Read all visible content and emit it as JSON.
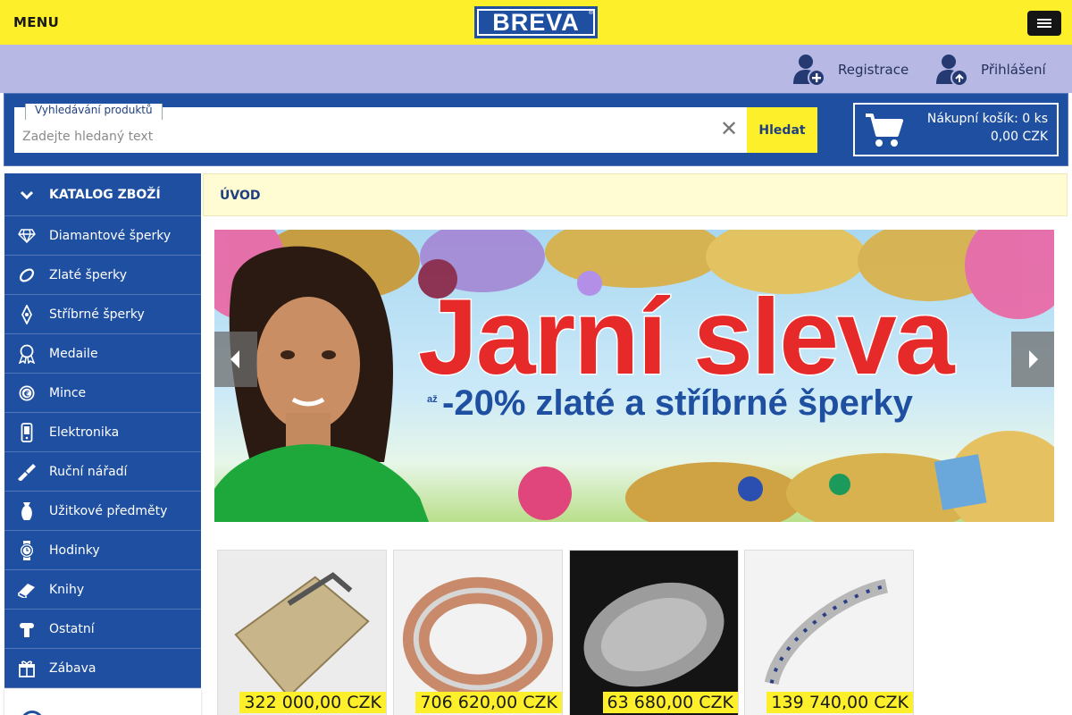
{
  "topbar": {
    "menu_label": "MENU",
    "logo_text": "BREVA",
    "logo_reg": "®"
  },
  "account": {
    "register_label": "Registrace",
    "login_label": "Přihlášení"
  },
  "search": {
    "legend": "Vyhledávání produktů",
    "placeholder": "Zadejte hledaný text",
    "clear_symbol": "✕",
    "button_label": "Hledat"
  },
  "cart": {
    "line1": "Nákupní košík: 0 ks",
    "line2": "0,00 CZK"
  },
  "sidebar": {
    "header_label": "KATALOG ZBOŽÍ",
    "items": [
      {
        "label": "Diamantové šperky",
        "icon": "diamond-icon"
      },
      {
        "label": "Zlaté šperky",
        "icon": "ring-icon"
      },
      {
        "label": "Stříbrné šperky",
        "icon": "pendant-icon"
      },
      {
        "label": "Medaile",
        "icon": "medal-icon"
      },
      {
        "label": "Mince",
        "icon": "coin-icon"
      },
      {
        "label": "Elektronika",
        "icon": "phone-icon"
      },
      {
        "label": "Ruční nářadí",
        "icon": "tool-icon"
      },
      {
        "label": "Užitkové předměty",
        "icon": "vase-icon"
      },
      {
        "label": "Hodinky",
        "icon": "watch-icon"
      },
      {
        "label": "Knihy",
        "icon": "book-icon"
      },
      {
        "label": "Ostatní",
        "icon": "misc-icon"
      },
      {
        "label": "Zábava",
        "icon": "gift-icon"
      }
    ]
  },
  "breadcrumb": {
    "label": "ÚVOD"
  },
  "banner": {
    "title": "Jarní sleva",
    "prefix": "až",
    "subtitle": "-20% zlaté a stříbrné šperky"
  },
  "products": [
    {
      "price": "322 000,00 CZK",
      "image": "gold-cigarette-case"
    },
    {
      "price": "706 620,00 CZK",
      "image": "rose-gold-bangle"
    },
    {
      "price": "63 680,00 CZK",
      "image": "silver-oval-tray"
    },
    {
      "price": "139 740,00 CZK",
      "image": "sapphire-bracelet"
    }
  ],
  "colors": {
    "accent_yellow": "#fdf02a",
    "brand_blue": "#1f4fa0",
    "account_band": "#b7b9e4"
  }
}
